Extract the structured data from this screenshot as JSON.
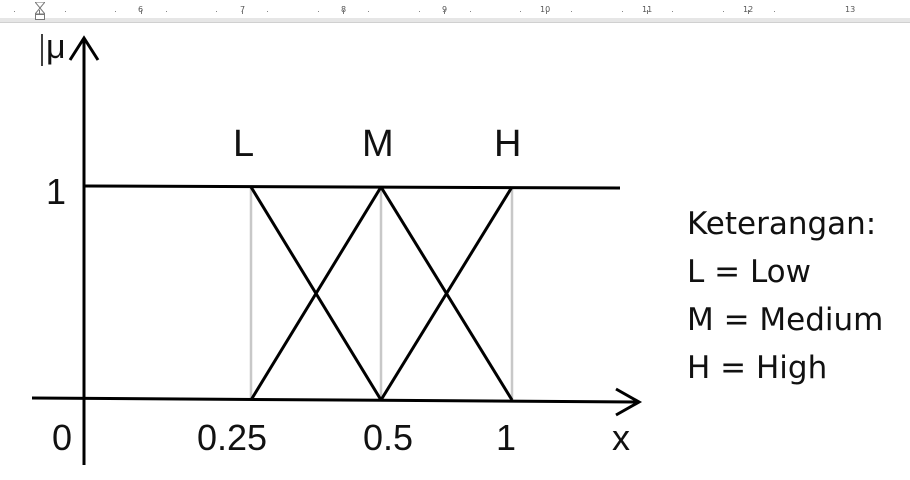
{
  "ruler": {
    "numbers": [
      "6",
      "7",
      "8",
      "9",
      "10",
      "11",
      "12",
      "13"
    ]
  },
  "diagram": {
    "y_axis_label": "μ",
    "x_axis_label": "x",
    "y_tick_one": "1",
    "origin_label": "0",
    "x_ticks": [
      "0.25",
      "0.5",
      "1"
    ],
    "set_labels": [
      "L",
      "M",
      "H"
    ],
    "line_color": "#000000",
    "guide_color": "#c8c8c8"
  },
  "legend": {
    "title": "Keterangan:",
    "items": [
      "L = Low",
      "M = Medium",
      "H = High"
    ]
  }
}
